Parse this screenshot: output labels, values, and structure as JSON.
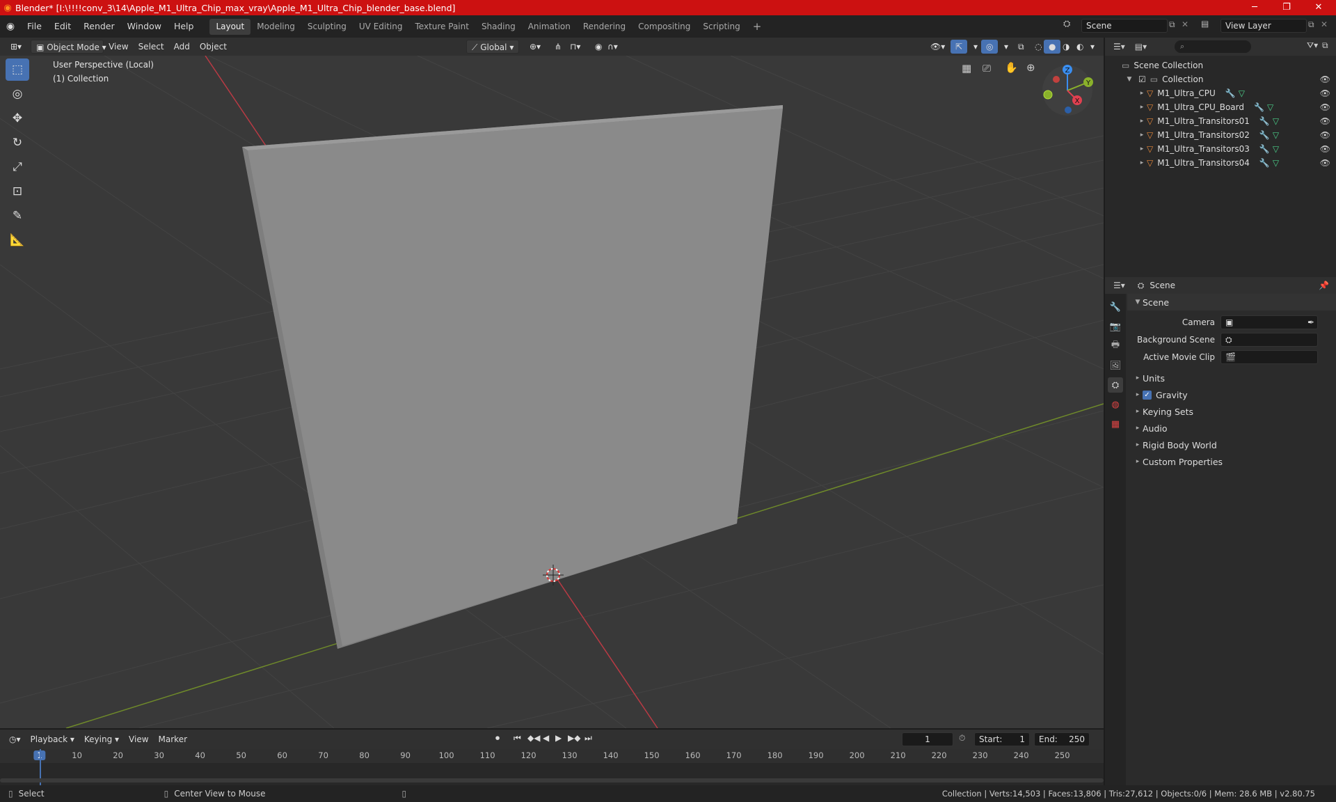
{
  "window": {
    "title": "Blender* [I:\\!!!!conv_3\\14\\Apple_M1_Ultra_Chip_max_vray\\Apple_M1_Ultra_Chip_blender_base.blend]",
    "minimize": "─",
    "maximize": "❐",
    "close": "✕"
  },
  "menus": [
    "File",
    "Edit",
    "Render",
    "Window",
    "Help"
  ],
  "workspaces": [
    "Layout",
    "Modeling",
    "Sculpting",
    "UV Editing",
    "Texture Paint",
    "Shading",
    "Animation",
    "Rendering",
    "Compositing",
    "Scripting"
  ],
  "add_workspace": "+",
  "scene_field": "Scene",
  "view_layer_field": "View Layer",
  "viewport_header": {
    "mode": "Object Mode",
    "menus": [
      "View",
      "Select",
      "Add",
      "Object"
    ],
    "orientation": "Global"
  },
  "viewport": {
    "perspective_label": "User Perspective (Local)",
    "collection_label": "(1) Collection",
    "gizmo_axes": {
      "x": "X",
      "y": "Y",
      "z": "Z"
    }
  },
  "outliner": {
    "search_placeholder": "",
    "root": "Scene Collection",
    "collection": "Collection",
    "objects": [
      "M1_Ultra_CPU",
      "M1_Ultra_CPU_Board",
      "M1_Ultra_Transitors01",
      "M1_Ultra_Transitors02",
      "M1_Ultra_Transitors03",
      "M1_Ultra_Transitors04"
    ]
  },
  "properties": {
    "header": "Scene",
    "section": "Scene",
    "fields": [
      {
        "label": "Camera",
        "value": ""
      },
      {
        "label": "Background Scene",
        "value": ""
      },
      {
        "label": "Active Movie Clip",
        "value": ""
      }
    ],
    "panels": [
      "Units",
      "Gravity",
      "Keying Sets",
      "Audio",
      "Rigid Body World",
      "Custom Properties"
    ],
    "gravity_checked": true
  },
  "timeline": {
    "menus": [
      "Playback",
      "Keying",
      "View",
      "Marker"
    ],
    "current_frame": "1",
    "start_label": "Start:",
    "start": "1",
    "end_label": "End:",
    "end": "250",
    "ruler": [
      "1",
      "10",
      "20",
      "30",
      "40",
      "50",
      "60",
      "70",
      "80",
      "90",
      "100",
      "110",
      "120",
      "130",
      "140",
      "150",
      "160",
      "170",
      "180",
      "190",
      "200",
      "210",
      "220",
      "230",
      "240",
      "250"
    ]
  },
  "statusbar": {
    "select": "Select",
    "center": "Center View to Mouse",
    "stats": "Collection | Verts:14,503 | Faces:13,806 | Tris:27,612 | Objects:0/6 | Mem: 28.6 MB | v2.80.75"
  },
  "colors": {
    "title_bar": "#cc1111",
    "active_tool": "#4772b3",
    "x_axis": "#e04050",
    "y_axis": "#8ab12b",
    "z_axis": "#3a8ef0",
    "mesh_icon": "#e8883a",
    "frame_indicator": "#4772b3"
  }
}
